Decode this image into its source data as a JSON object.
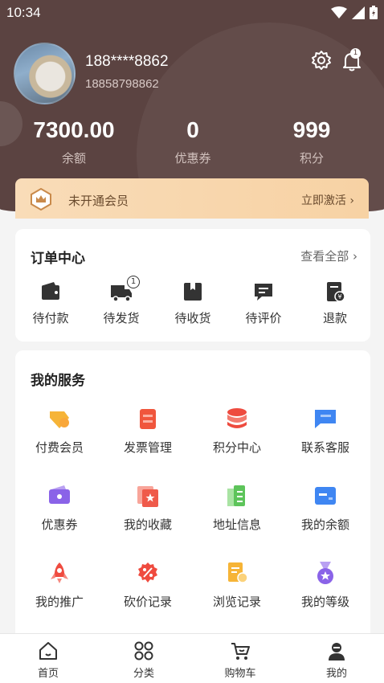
{
  "status": {
    "time": "10:34"
  },
  "user": {
    "name": "188****8862",
    "phone": "18858798862",
    "notification_count": "1"
  },
  "stats": [
    {
      "value": "7300.00",
      "label": "余额"
    },
    {
      "value": "0",
      "label": "优惠券"
    },
    {
      "value": "999",
      "label": "积分"
    }
  ],
  "vip": {
    "text": "未开通会员",
    "action": "立即激活"
  },
  "orders": {
    "title": "订单中心",
    "more": "查看全部",
    "items": [
      {
        "label": "待付款",
        "icon": "wallet-icon"
      },
      {
        "label": "待发货",
        "icon": "truck-icon",
        "badge": "1"
      },
      {
        "label": "待收货",
        "icon": "box-icon"
      },
      {
        "label": "待评价",
        "icon": "comment-icon"
      },
      {
        "label": "退款",
        "icon": "refund-icon"
      }
    ]
  },
  "services": {
    "title": "我的服务",
    "items": [
      {
        "label": "付费会员",
        "icon": "vip-tag-icon",
        "color": "#f6b437"
      },
      {
        "label": "发票管理",
        "icon": "invoice-icon",
        "color": "#f0563d"
      },
      {
        "label": "积分中心",
        "icon": "points-stack-icon",
        "color": "#ee4b3f"
      },
      {
        "label": "联系客服",
        "icon": "chat-icon",
        "color": "#3f86f2"
      },
      {
        "label": "优惠券",
        "icon": "coupon-icon",
        "color": "#8a63e8"
      },
      {
        "label": "我的收藏",
        "icon": "favorite-icon",
        "color": "#ef5a4a"
      },
      {
        "label": "地址信息",
        "icon": "address-book-icon",
        "color": "#5dc45a"
      },
      {
        "label": "我的余额",
        "icon": "card-icon",
        "color": "#3f86f2"
      },
      {
        "label": "我的推广",
        "icon": "rocket-icon",
        "color": "#ef4b3f"
      },
      {
        "label": "砍价记录",
        "icon": "discount-icon",
        "color": "#ef4b3f"
      },
      {
        "label": "浏览记录",
        "icon": "history-icon",
        "color": "#f6b437"
      },
      {
        "label": "我的等级",
        "icon": "medal-icon",
        "color": "#8a63e8"
      }
    ]
  },
  "tabbar": [
    {
      "label": "首页",
      "icon": "home-icon"
    },
    {
      "label": "分类",
      "icon": "category-icon"
    },
    {
      "label": "购物车",
      "icon": "cart-icon"
    },
    {
      "label": "我的",
      "icon": "profile-icon"
    }
  ]
}
